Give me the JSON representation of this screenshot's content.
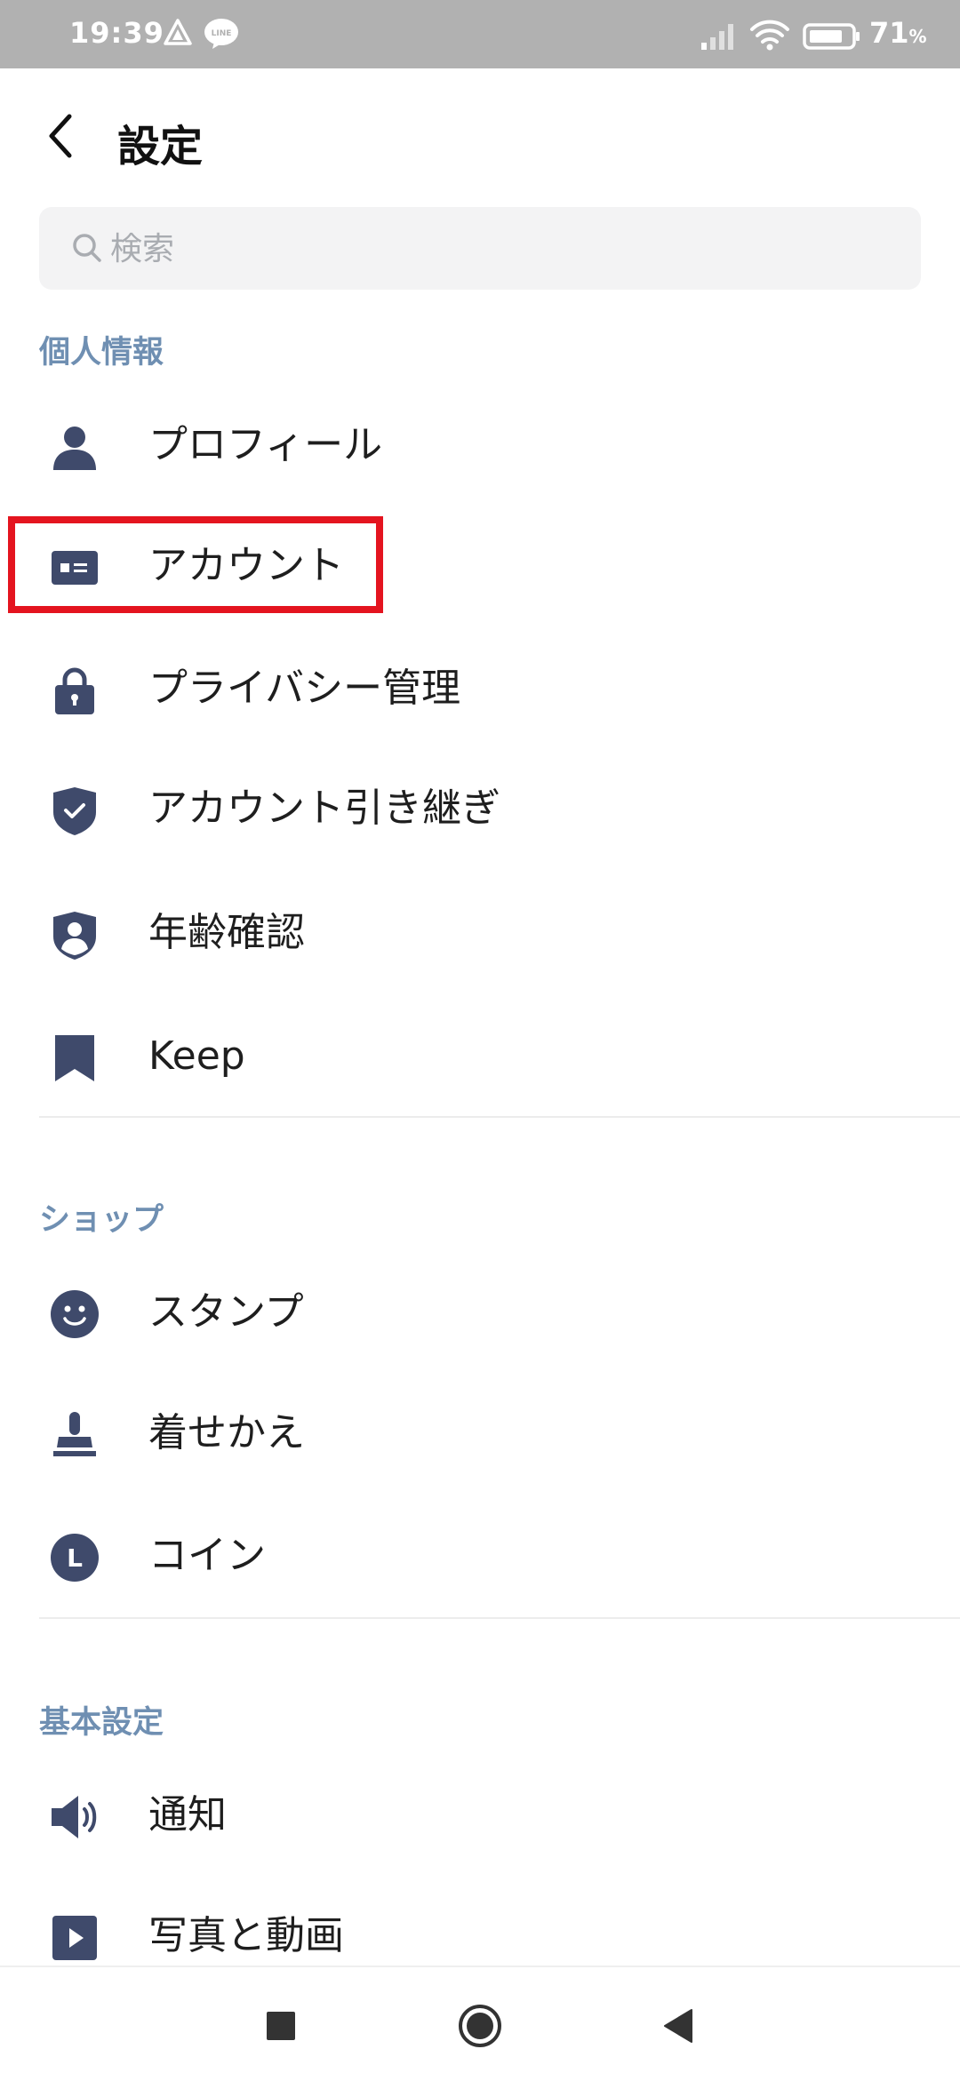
{
  "status_bar": {
    "time": "19:39",
    "notification_icons": [
      "navigation-triangle-icon",
      "line-bubble-icon"
    ],
    "line_badge_text": "LINE",
    "battery_value": "71",
    "battery_unit": "%"
  },
  "header": {
    "title": "設定",
    "back_icon": "chevron-left-icon"
  },
  "search": {
    "placeholder": "検索",
    "value": ""
  },
  "sections": [
    {
      "title": "個人情報",
      "items": [
        {
          "label": "プロフィール",
          "icon": "person-icon"
        },
        {
          "label": "アカウント",
          "icon": "id-card-icon",
          "highlighted": true
        },
        {
          "label": "プライバシー管理",
          "icon": "lock-icon"
        },
        {
          "label": "アカウント引き継ぎ",
          "icon": "shield-check-icon"
        },
        {
          "label": "年齢確認",
          "icon": "shield-person-icon"
        },
        {
          "label": "Keep",
          "icon": "bookmark-icon"
        }
      ]
    },
    {
      "title": "ショップ",
      "items": [
        {
          "label": "スタンプ",
          "icon": "smiley-icon"
        },
        {
          "label": "着せかえ",
          "icon": "brush-icon"
        },
        {
          "label": "コイン",
          "icon": "coin-icon",
          "icon_letter": "L"
        }
      ]
    },
    {
      "title": "基本設定",
      "items": [
        {
          "label": "通知",
          "icon": "speaker-icon"
        },
        {
          "label": "写真と動画",
          "icon": "play-icon"
        }
      ]
    }
  ],
  "nav_bar": {
    "buttons": [
      "recents-square-icon",
      "home-circle-icon",
      "back-triangle-icon"
    ]
  },
  "colors": {
    "status_bar_bg": "#b1b1b1",
    "section_title": "#6f8fb2",
    "icon": "#3f4a6b",
    "highlight_border": "#e4141f",
    "search_bg": "#f3f3f4"
  }
}
